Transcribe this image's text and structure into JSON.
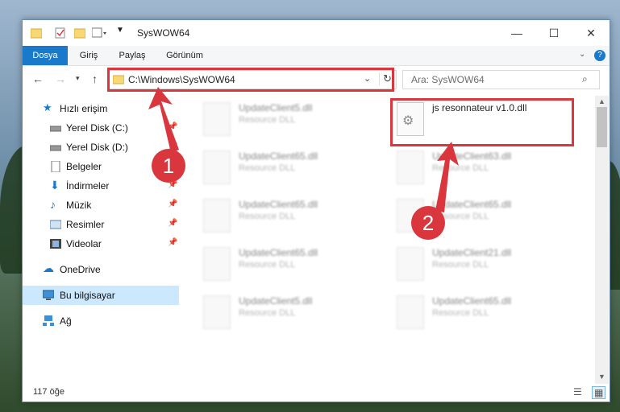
{
  "window": {
    "title": "SysWOW64",
    "controls": {
      "minimize": "—",
      "maximize": "☐",
      "close": "✕"
    }
  },
  "ribbon": {
    "tabs": [
      {
        "label": "Dosya",
        "active": true
      },
      {
        "label": "Giriş"
      },
      {
        "label": "Paylaş"
      },
      {
        "label": "Görünüm"
      }
    ],
    "help_icon": "?"
  },
  "address_bar": {
    "path": "C:\\Windows\\SysWOW64"
  },
  "search": {
    "placeholder": "Ara: SysWOW64"
  },
  "sidebar": {
    "items": [
      {
        "label": "Hızlı erişim",
        "icon": "star-icon"
      },
      {
        "label": "Yerel Disk (C:)",
        "icon": "drive-icon",
        "pinned": true
      },
      {
        "label": "Yerel Disk (D:)",
        "icon": "drive-icon",
        "pinned": true
      },
      {
        "label": "Belgeler",
        "icon": "document-icon",
        "pinned": true
      },
      {
        "label": "İndirmeler",
        "icon": "download-icon",
        "pinned": true
      },
      {
        "label": "Müzik",
        "icon": "music-icon",
        "pinned": true
      },
      {
        "label": "Resimler",
        "icon": "pictures-icon",
        "pinned": true
      },
      {
        "label": "Videolar",
        "icon": "video-icon",
        "pinned": true
      },
      {
        "label": "OneDrive",
        "icon": "cloud-icon"
      },
      {
        "label": "Bu bilgisayar",
        "icon": "computer-icon",
        "selected": true
      },
      {
        "label": "Ağ",
        "icon": "network-icon"
      }
    ]
  },
  "files": {
    "left_column": [
      {
        "name": "UpdateClient5.dll",
        "type": "Resource DLL"
      },
      {
        "name": "UpdateClient65.dll",
        "type": "Resource DLL"
      },
      {
        "name": "UpdateClient65.dll",
        "type": "Resource DLL"
      },
      {
        "name": "UpdateClient65.dll",
        "type": "Resource DLL"
      },
      {
        "name": "UpdateClient5.dll",
        "type": "Resource DLL"
      }
    ],
    "right_column": [
      {
        "name": "js resonnateur v1.0.dll",
        "type": ""
      },
      {
        "name": "UpdateClient63.dll",
        "type": "Resource DLL"
      },
      {
        "name": "UpdateClient65.dll",
        "type": "Resource DLL"
      },
      {
        "name": "UpdateClient21.dll",
        "type": "Resource DLL"
      },
      {
        "name": "UpdateClient65.dll",
        "type": "Resource DLL"
      }
    ]
  },
  "status": {
    "count": "117 öğe"
  },
  "annotations": {
    "step1": "1",
    "step2": "2",
    "color": "#d9363e"
  }
}
